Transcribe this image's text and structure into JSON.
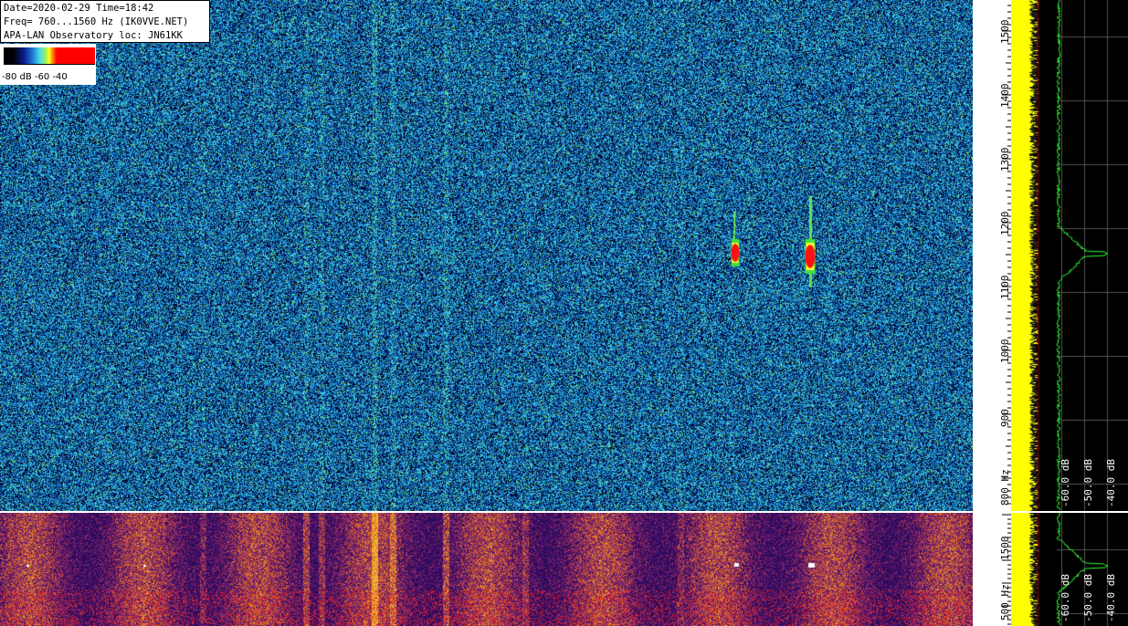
{
  "header": {
    "line1": "Date=2020-02-29 Time=18:42",
    "line2": "Freq= 760...1560 Hz (IK0VVE.NET)",
    "line3": "APA-LAN Observatory loc: JN61KK"
  },
  "colorbar": {
    "label": "-80 dB -60    -40"
  },
  "freq_axis_top": {
    "ticks": [
      "1500",
      "1400",
      "1300",
      "1200",
      "1100",
      "1000",
      "900",
      "800 Hz"
    ]
  },
  "freq_axis_bottom": {
    "ticks": [
      "1500",
      "500 Hz"
    ]
  },
  "spectrum_top": {
    "db_labels": [
      "-60.0 dB",
      "-50.0 dB",
      "-40.0 dB"
    ]
  },
  "spectrum_bottom": {
    "db_labels": [
      "-60.0 dB",
      "-50.0 dB",
      "-40.0 dB"
    ]
  },
  "colors": {
    "spectrum_yellow": "#ffff00",
    "spectrum_green": "#30ff30",
    "signal_red": "#ff0000"
  }
}
